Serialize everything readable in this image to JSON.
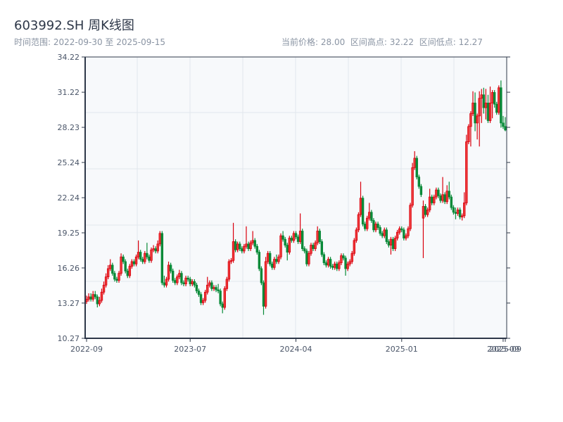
{
  "header": {
    "title": "603992.SH 周K线图",
    "range_label": "时间范围: 2022-09-30 至 2025-09-15",
    "current_price": "当前价格: 28.00",
    "range_high": "区间高点: 32.22",
    "range_low": "区间低点: 12.27"
  },
  "chart_data": {
    "type": "candlestick",
    "title": "603992.SH 周K线图",
    "ylim": [
      10.27,
      34.22
    ],
    "y_ticks": [
      "10.27",
      "13.27",
      "16.26",
      "19.25",
      "22.24",
      "25.24",
      "28.23",
      "31.22",
      "34.22"
    ],
    "x_ticks": [
      {
        "label": "2022-09",
        "index": 0
      },
      {
        "label": "2023-07",
        "index": 48
      },
      {
        "label": "2024-04",
        "index": 97
      },
      {
        "label": "2025-01",
        "index": 146
      },
      {
        "label": "2025-09",
        "index": 193
      },
      {
        "label": "2025-09",
        "index": 194
      }
    ],
    "grid": true,
    "colors": {
      "up": "#d9000d",
      "up_fill": "#f03a3a",
      "down": "#088a38",
      "background": "#f7f9fb",
      "axis": "#2d3748",
      "grid": "#e2e6ec"
    },
    "ohlc_fields": [
      "open",
      "high",
      "low",
      "close"
    ],
    "candles": [
      [
        13.4,
        13.9,
        13.2,
        13.6
      ],
      [
        13.6,
        14.1,
        13.4,
        13.8
      ],
      [
        13.8,
        14.1,
        13.4,
        13.6
      ],
      [
        13.6,
        14.3,
        13.4,
        14.0
      ],
      [
        14.0,
        14.3,
        13.6,
        13.8
      ],
      [
        13.8,
        14.0,
        12.9,
        13.2
      ],
      [
        13.2,
        13.8,
        13.0,
        13.5
      ],
      [
        13.5,
        14.5,
        13.3,
        14.2
      ],
      [
        14.2,
        15.1,
        14.0,
        14.8
      ],
      [
        14.8,
        15.8,
        14.6,
        15.5
      ],
      [
        15.5,
        16.5,
        15.3,
        16.2
      ],
      [
        16.2,
        17.0,
        16.0,
        16.5
      ],
      [
        16.5,
        16.7,
        15.6,
        15.8
      ],
      [
        15.8,
        16.0,
        15.1,
        15.3
      ],
      [
        15.3,
        15.5,
        15.0,
        15.2
      ],
      [
        15.2,
        16.0,
        15.0,
        15.8
      ],
      [
        15.8,
        17.5,
        15.6,
        17.2
      ],
      [
        17.2,
        17.4,
        16.6,
        16.8
      ],
      [
        16.8,
        17.0,
        15.8,
        16.0
      ],
      [
        16.0,
        16.2,
        15.4,
        15.6
      ],
      [
        15.6,
        16.6,
        15.4,
        16.4
      ],
      [
        16.4,
        17.0,
        16.2,
        16.8
      ],
      [
        16.8,
        17.0,
        16.4,
        16.6
      ],
      [
        16.6,
        17.4,
        16.4,
        17.2
      ],
      [
        17.2,
        18.6,
        17.0,
        17.6
      ],
      [
        17.6,
        17.8,
        16.8,
        17.0
      ],
      [
        17.0,
        17.2,
        16.6,
        16.8
      ],
      [
        16.8,
        17.7,
        16.6,
        17.5
      ],
      [
        17.5,
        18.4,
        17.0,
        17.2
      ],
      [
        17.2,
        17.4,
        16.7,
        16.9
      ],
      [
        16.9,
        18.0,
        16.7,
        17.8
      ],
      [
        17.8,
        18.2,
        17.6,
        17.9
      ],
      [
        17.9,
        18.1,
        17.5,
        17.7
      ],
      [
        17.7,
        18.6,
        17.5,
        18.3
      ],
      [
        18.3,
        19.4,
        18.1,
        19.2
      ],
      [
        19.2,
        19.4,
        14.8,
        15.0
      ],
      [
        15.0,
        15.6,
        14.6,
        14.8
      ],
      [
        14.8,
        15.5,
        14.6,
        15.3
      ],
      [
        15.3,
        16.8,
        15.1,
        16.5
      ],
      [
        16.5,
        16.7,
        15.8,
        16.0
      ],
      [
        16.0,
        16.2,
        15.0,
        15.2
      ],
      [
        15.2,
        15.4,
        14.8,
        15.0
      ],
      [
        15.0,
        15.7,
        14.8,
        15.5
      ],
      [
        15.5,
        16.1,
        15.3,
        15.8
      ],
      [
        15.8,
        16.0,
        14.8,
        15.0
      ],
      [
        15.0,
        15.2,
        14.7,
        14.9
      ],
      [
        14.9,
        15.6,
        14.7,
        15.4
      ],
      [
        15.4,
        15.6,
        15.1,
        15.3
      ],
      [
        15.3,
        15.5,
        14.7,
        14.9
      ],
      [
        14.9,
        15.3,
        14.7,
        15.1
      ],
      [
        15.1,
        15.3,
        14.6,
        14.8
      ],
      [
        14.8,
        15.0,
        14.1,
        14.3
      ],
      [
        14.3,
        14.5,
        13.8,
        14.0
      ],
      [
        14.0,
        14.2,
        13.1,
        13.3
      ],
      [
        13.3,
        13.7,
        13.1,
        13.5
      ],
      [
        13.5,
        14.4,
        13.3,
        14.2
      ],
      [
        14.2,
        15.5,
        14.0,
        14.8
      ],
      [
        14.8,
        15.2,
        14.6,
        15.0
      ],
      [
        15.0,
        15.2,
        14.3,
        14.5
      ],
      [
        14.5,
        14.8,
        14.3,
        14.6
      ],
      [
        14.6,
        14.8,
        14.2,
        14.4
      ],
      [
        14.4,
        14.9,
        14.1,
        14.3
      ],
      [
        14.3,
        14.5,
        13.0,
        13.2
      ],
      [
        13.2,
        13.4,
        12.4,
        12.9
      ],
      [
        12.9,
        14.7,
        12.7,
        14.5
      ],
      [
        14.5,
        15.5,
        14.3,
        15.3
      ],
      [
        15.3,
        17.0,
        15.1,
        16.8
      ],
      [
        16.8,
        17.1,
        16.6,
        16.9
      ],
      [
        16.9,
        20.1,
        16.7,
        18.5
      ],
      [
        18.5,
        18.7,
        17.6,
        17.8
      ],
      [
        17.8,
        18.5,
        17.6,
        18.3
      ],
      [
        18.3,
        18.5,
        17.7,
        17.9
      ],
      [
        17.9,
        18.1,
        17.5,
        17.7
      ],
      [
        17.7,
        18.3,
        17.5,
        18.1
      ],
      [
        18.1,
        19.8,
        17.9,
        18.3
      ],
      [
        18.3,
        18.5,
        17.7,
        17.9
      ],
      [
        17.9,
        18.6,
        17.7,
        18.4
      ],
      [
        18.4,
        19.4,
        18.2,
        18.6
      ],
      [
        18.6,
        18.8,
        17.9,
        18.1
      ],
      [
        18.1,
        18.3,
        17.4,
        17.6
      ],
      [
        17.6,
        17.8,
        16.0,
        16.2
      ],
      [
        16.2,
        16.4,
        14.8,
        15.0
      ],
      [
        15.0,
        15.2,
        12.27,
        13.0
      ],
      [
        13.0,
        17.2,
        12.8,
        16.8
      ],
      [
        16.8,
        17.7,
        16.6,
        17.5
      ],
      [
        17.5,
        17.7,
        16.4,
        16.6
      ],
      [
        16.6,
        16.8,
        16.1,
        16.3
      ],
      [
        16.3,
        17.2,
        16.1,
        17.0
      ],
      [
        17.0,
        17.4,
        16.6,
        16.8
      ],
      [
        16.8,
        17.4,
        16.6,
        17.2
      ],
      [
        17.2,
        19.2,
        17.0,
        19.0
      ],
      [
        19.0,
        19.4,
        18.5,
        18.7
      ],
      [
        18.7,
        18.9,
        18.0,
        18.2
      ],
      [
        18.2,
        18.4,
        16.9,
        17.6
      ],
      [
        17.6,
        19.0,
        17.4,
        18.8
      ],
      [
        18.8,
        19.0,
        18.4,
        18.6
      ],
      [
        18.6,
        19.4,
        18.4,
        19.2
      ],
      [
        19.2,
        19.4,
        18.7,
        18.9
      ],
      [
        18.9,
        19.1,
        18.3,
        18.5
      ],
      [
        18.5,
        20.9,
        18.3,
        19.4
      ],
      [
        19.4,
        19.6,
        17.7,
        17.9
      ],
      [
        17.9,
        18.1,
        17.5,
        17.7
      ],
      [
        17.7,
        17.9,
        16.4,
        16.6
      ],
      [
        16.6,
        17.7,
        16.4,
        17.5
      ],
      [
        17.5,
        18.4,
        17.3,
        18.2
      ],
      [
        18.2,
        18.4,
        17.7,
        17.9
      ],
      [
        17.9,
        18.6,
        17.7,
        18.4
      ],
      [
        18.4,
        19.8,
        18.2,
        19.4
      ],
      [
        19.4,
        19.6,
        18.3,
        18.5
      ],
      [
        18.5,
        18.7,
        17.2,
        17.4
      ],
      [
        17.4,
        17.6,
        16.5,
        16.7
      ],
      [
        16.7,
        16.9,
        16.3,
        16.5
      ],
      [
        16.5,
        17.2,
        16.3,
        17.0
      ],
      [
        17.0,
        17.2,
        16.2,
        16.4
      ],
      [
        16.4,
        16.6,
        16.1,
        16.3
      ],
      [
        16.3,
        16.8,
        16.1,
        16.6
      ],
      [
        16.6,
        16.8,
        16.0,
        16.2
      ],
      [
        16.2,
        16.9,
        16.0,
        16.7
      ],
      [
        16.7,
        17.5,
        16.5,
        17.3
      ],
      [
        17.3,
        17.5,
        16.9,
        17.1
      ],
      [
        17.1,
        17.3,
        15.6,
        16.2
      ],
      [
        16.2,
        16.8,
        16.0,
        16.6
      ],
      [
        16.6,
        17.0,
        16.4,
        16.8
      ],
      [
        16.8,
        17.7,
        16.6,
        17.5
      ],
      [
        17.5,
        18.8,
        17.3,
        18.6
      ],
      [
        18.6,
        19.7,
        18.4,
        19.5
      ],
      [
        19.5,
        21.0,
        19.3,
        20.8
      ],
      [
        20.8,
        23.6,
        20.6,
        22.2
      ],
      [
        22.2,
        22.4,
        19.8,
        20.0
      ],
      [
        20.0,
        20.2,
        19.4,
        19.6
      ],
      [
        19.6,
        20.7,
        19.4,
        20.5
      ],
      [
        20.5,
        21.8,
        20.3,
        21.0
      ],
      [
        21.0,
        21.2,
        20.1,
        20.3
      ],
      [
        20.3,
        20.5,
        19.3,
        19.5
      ],
      [
        19.5,
        20.2,
        19.3,
        20.0
      ],
      [
        20.0,
        20.2,
        19.5,
        19.7
      ],
      [
        19.7,
        19.9,
        19.0,
        19.2
      ],
      [
        19.2,
        19.4,
        18.8,
        19.0
      ],
      [
        19.0,
        19.7,
        18.8,
        19.5
      ],
      [
        19.5,
        19.7,
        18.3,
        18.5
      ],
      [
        18.5,
        18.7,
        18.0,
        18.2
      ],
      [
        18.2,
        18.9,
        17.4,
        18.7
      ],
      [
        18.7,
        18.9,
        17.7,
        17.9
      ],
      [
        17.9,
        19.0,
        17.7,
        18.8
      ],
      [
        18.8,
        19.5,
        18.6,
        19.3
      ],
      [
        19.3,
        19.8,
        19.1,
        19.6
      ],
      [
        19.6,
        19.8,
        19.3,
        19.5
      ],
      [
        19.5,
        19.7,
        18.6,
        18.8
      ],
      [
        18.8,
        19.2,
        18.6,
        19.0
      ],
      [
        19.0,
        19.8,
        18.8,
        19.6
      ],
      [
        19.6,
        21.8,
        19.4,
        21.6
      ],
      [
        21.6,
        25.2,
        21.4,
        24.8
      ],
      [
        24.8,
        26.2,
        24.6,
        25.6
      ],
      [
        25.6,
        25.8,
        23.8,
        24.0
      ],
      [
        24.0,
        24.2,
        23.0,
        23.2
      ],
      [
        23.2,
        23.4,
        22.3,
        22.5
      ],
      [
        20.5,
        22.0,
        17.1,
        21.5
      ],
      [
        21.5,
        21.7,
        20.6,
        20.8
      ],
      [
        20.8,
        21.4,
        20.6,
        21.2
      ],
      [
        21.2,
        23.0,
        21.0,
        22.3
      ],
      [
        22.3,
        22.5,
        21.6,
        21.8
      ],
      [
        21.8,
        22.5,
        21.6,
        22.3
      ],
      [
        22.3,
        23.1,
        22.1,
        22.9
      ],
      [
        22.9,
        23.1,
        22.2,
        22.4
      ],
      [
        22.4,
        22.6,
        21.8,
        22.0
      ],
      [
        22.0,
        24.0,
        21.8,
        22.5
      ],
      [
        22.5,
        22.7,
        21.7,
        21.9
      ],
      [
        21.9,
        23.3,
        21.7,
        22.8
      ],
      [
        22.8,
        23.6,
        22.1,
        22.3
      ],
      [
        22.3,
        22.5,
        21.2,
        21.4
      ],
      [
        21.4,
        21.6,
        20.8,
        21.0
      ],
      [
        21.0,
        21.4,
        20.4,
        20.9
      ],
      [
        20.9,
        21.4,
        20.7,
        21.2
      ],
      [
        21.2,
        21.4,
        20.4,
        20.6
      ],
      [
        20.6,
        20.9,
        20.3,
        20.7
      ],
      [
        20.7,
        22.7,
        20.5,
        21.8
      ],
      [
        21.8,
        27.6,
        21.6,
        27.0
      ],
      [
        27.0,
        28.5,
        26.8,
        28.3
      ],
      [
        28.3,
        29.6,
        26.6,
        29.4
      ],
      [
        29.4,
        31.3,
        29.2,
        30.3
      ],
      [
        30.3,
        31.2,
        27.9,
        28.6
      ],
      [
        28.6,
        29.4,
        27.2,
        29.2
      ],
      [
        29.2,
        31.3,
        26.6,
        30.7
      ],
      [
        30.7,
        31.5,
        28.6,
        31.0
      ],
      [
        31.0,
        31.6,
        29.4,
        29.9
      ],
      [
        29.9,
        31.5,
        28.9,
        30.3
      ],
      [
        30.3,
        31.0,
        28.6,
        28.8
      ],
      [
        28.8,
        31.7,
        28.6,
        30.3
      ],
      [
        30.3,
        31.4,
        29.0,
        31.2
      ],
      [
        31.2,
        31.4,
        29.9,
        30.2
      ],
      [
        30.2,
        30.4,
        29.3,
        29.5
      ],
      [
        29.5,
        31.8,
        29.3,
        31.6
      ],
      [
        31.6,
        32.22,
        28.2,
        28.6
      ],
      [
        28.6,
        29.2,
        28.1,
        28.3
      ],
      [
        28.3,
        29.1,
        27.9,
        28.0
      ]
    ]
  }
}
